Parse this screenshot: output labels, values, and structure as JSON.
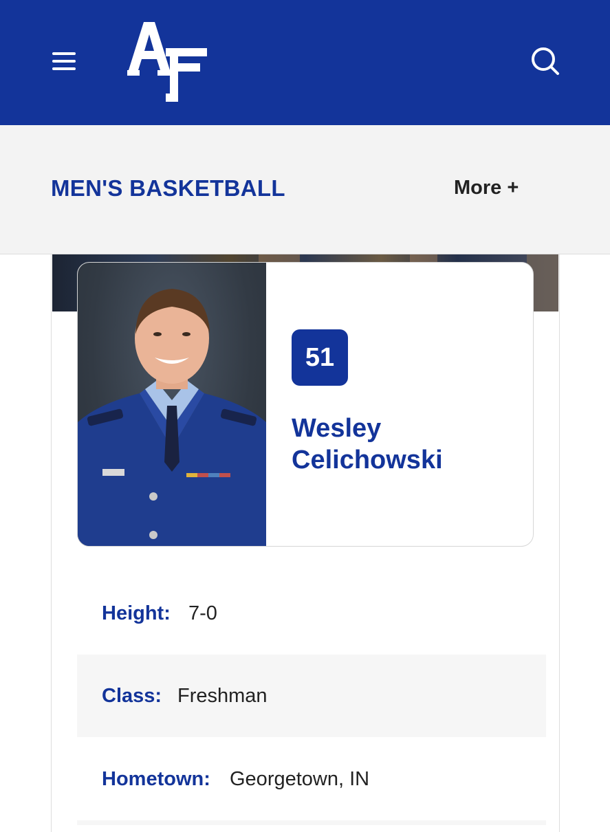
{
  "header": {
    "logo_text": "AF",
    "menu_icon": "hamburger-menu-icon",
    "search_icon": "search-icon",
    "brand_color": "#13349a"
  },
  "subnav": {
    "title": "MEN'S BASKETBALL",
    "more_label": "More +"
  },
  "player": {
    "jersey_number": "51",
    "first_name": "Wesley",
    "last_name": "Celichowski"
  },
  "bio": [
    {
      "label": "Height:",
      "value": "7-0"
    },
    {
      "label": "Class:",
      "value": "Freshman"
    },
    {
      "label": "Hometown:",
      "value": "Georgetown, IN"
    }
  ]
}
